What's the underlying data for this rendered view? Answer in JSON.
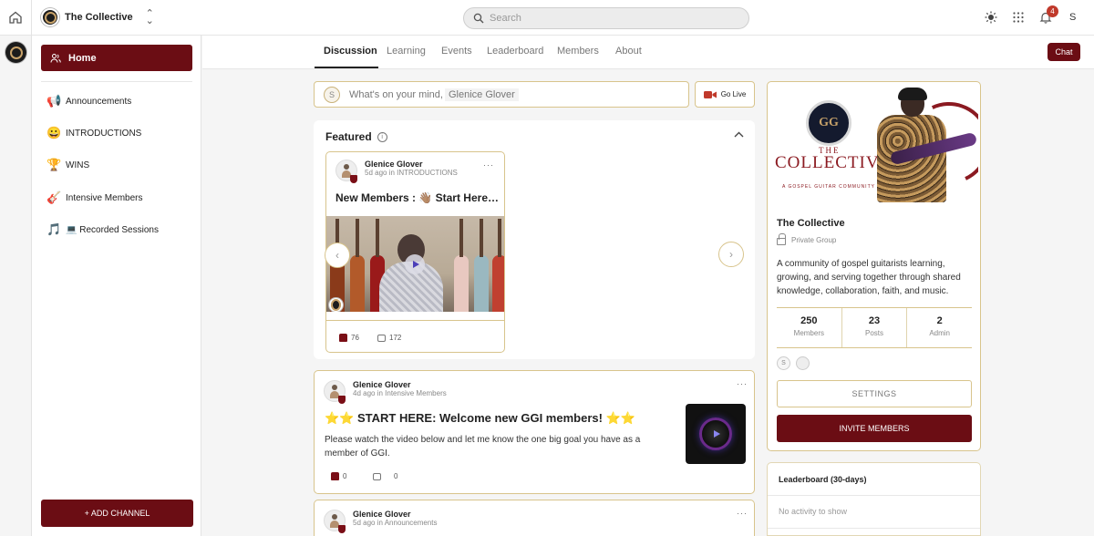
{
  "topbar": {
    "community_name": "The Collective",
    "search_placeholder": "Search",
    "notification_count": "4",
    "user_initial": "S"
  },
  "sidebar": {
    "home_label": "Home",
    "channels": [
      {
        "emoji": "📢",
        "label": "Announcements"
      },
      {
        "emoji": "😀",
        "label": "INTRODUCTIONS"
      },
      {
        "emoji": "🏆",
        "label": "WINS"
      },
      {
        "emoji": "🎸",
        "label": "Intensive Members"
      },
      {
        "emoji": "🎵",
        "label": "💻 Recorded Sessions"
      }
    ],
    "add_channel_label": "+ ADD CHANNEL"
  },
  "tabs": [
    "Discussion",
    "Learning",
    "Events",
    "Leaderboard",
    "Members",
    "About"
  ],
  "chat_label": "Chat",
  "composer": {
    "avatar_initial": "S",
    "prompt": "What's on your mind,",
    "name": "Glenice Glover",
    "golive_label": "Go Live"
  },
  "featured": {
    "title": "Featured",
    "card": {
      "author": "Glenice Glover",
      "time": "5d ago in",
      "channel": "INTRODUCTIONS",
      "title": "New Members : 👋🏽 Start Here…",
      "likes": "76",
      "comments": "172"
    }
  },
  "posts": [
    {
      "author": "Glenice Glover",
      "time": "4d ago in",
      "channel": "Intensive Members",
      "title": "⭐⭐ START HERE: Welcome new GGI members! ⭐⭐",
      "body": "Please watch the video below and let me know the one big goal you have as a member of GGI.",
      "likes": "0",
      "comments": "0"
    },
    {
      "author": "Glenice Glover",
      "time": "5d ago in",
      "channel": "Announcements"
    }
  ],
  "group": {
    "banner": {
      "seal": "GG",
      "the": "THE",
      "collective": "COLLECTIVE",
      "tagline": "A GOSPEL GUITAR COMMUNITY"
    },
    "name": "The Collective",
    "privacy": "Private Group",
    "description": "A community of gospel guitarists learning, growing, and serving together through shared knowledge, collaboration, faith, and music.",
    "stats": [
      {
        "value": "250",
        "label": "Members"
      },
      {
        "value": "23",
        "label": "Posts"
      },
      {
        "value": "2",
        "label": "Admin"
      }
    ],
    "member_initial": "S",
    "settings_label": "SETTINGS",
    "invite_label": "INVITE MEMBERS"
  },
  "leaderboard": {
    "title": "Leaderboard (30-days)",
    "empty": "No activity to show"
  },
  "colors": {
    "brand": "#6b0d14",
    "accent_border": "#d8c48c"
  }
}
